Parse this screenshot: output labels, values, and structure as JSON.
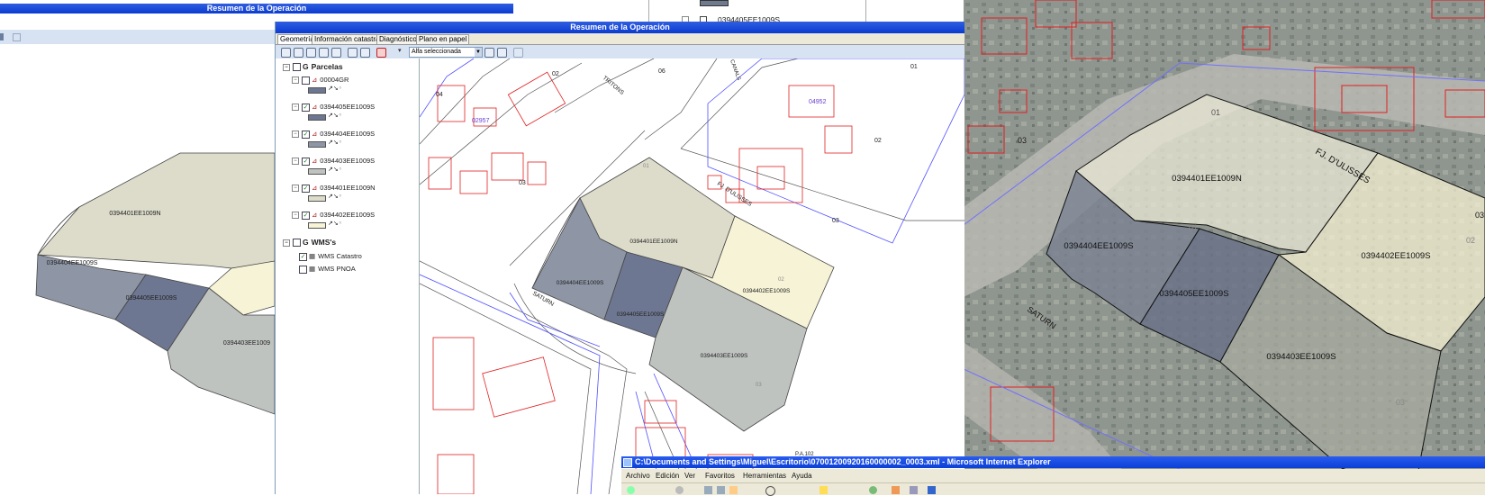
{
  "back_window": {
    "title": "Resumen de la Operación",
    "parcels": [
      {
        "id": "0394401EE1009N"
      },
      {
        "id": "0394404EE1009S"
      },
      {
        "id": "0394405EE1009S"
      },
      {
        "id": "0394403EE1009"
      }
    ]
  },
  "front_window": {
    "title": "Resumen de la Operación",
    "tabs": [
      "Geometría",
      "Información catastral",
      "Diagnóstico",
      "Plano en papel"
    ],
    "layer_select": "Alfa seleccionada",
    "tree": {
      "group_parcelas": "Parcelas",
      "layers": [
        "00004GR",
        "0394405EE1009S",
        "0394404EE1009S",
        "0394403EE1009S",
        "0394401EE1009N",
        "0394402EE1009S"
      ],
      "group_wms": "WMS's",
      "wms_layers": [
        "WMS Catastro",
        "WMS PNOA"
      ]
    },
    "map": {
      "parcel_labels": [
        "0394401EE1009N",
        "0394404EE1009S",
        "0394405EE1009S",
        "0394402EE1009S",
        "0394403EE1009S"
      ],
      "street_labels": [
        "TRITONS",
        "FJ. D'ULISSES",
        "SATURN",
        "CANALS"
      ],
      "numbers": [
        "02",
        "06",
        "01",
        "04",
        "02957",
        "03",
        "04952",
        "02",
        "03",
        "01",
        "02",
        "03",
        "02"
      ],
      "plan_ref": "P.A.102"
    }
  },
  "right_map": {
    "top_label": "0394405EE1009S",
    "parcel_labels": [
      "0394401EE1009N",
      "0394404EE1009S",
      "0394405EE1009S",
      "0394402EE1009S",
      "0394403EE1009S"
    ],
    "street_labels": [
      "FJ. D'ULISSES",
      "SATURN"
    ],
    "numbers": [
      "04",
      "01",
      "03",
      "02",
      "03",
      "01",
      "03"
    ]
  },
  "ie_window": {
    "title": "C:\\Documents and Settings\\Miguel\\Escritorio\\07001200920160000002_0003.xml - Microsoft Internet Explorer",
    "menu": [
      "Archivo",
      "Edición",
      "Ver",
      "Favoritos",
      "Herramientas",
      "Ayuda"
    ]
  },
  "colors": {
    "titlebar": "#0a3bd0",
    "parcel_light": "#dddccb",
    "parcel_blue": "#8e96a6",
    "parcel_dark": "#6e7791",
    "parcel_yellow": "#f7f3d6",
    "parcel_gray": "#bfc3c0",
    "cadastre_red": "#e02020"
  }
}
